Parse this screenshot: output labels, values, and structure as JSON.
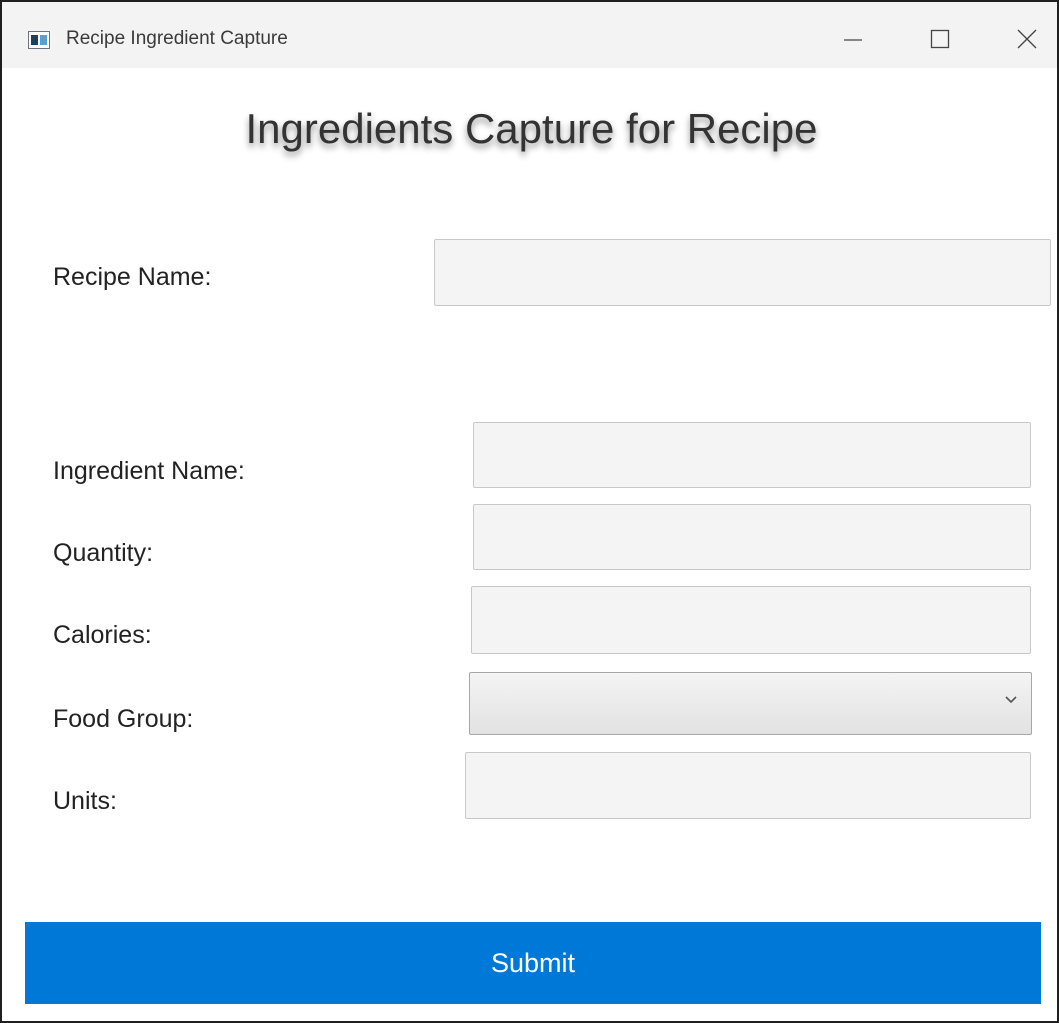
{
  "window": {
    "title": "Recipe Ingredient Capture",
    "controls": {
      "minimize": "minimize-icon",
      "maximize": "maximize-icon",
      "close": "close-icon"
    }
  },
  "form": {
    "heading": "Ingredients Capture for Recipe",
    "recipe_name": {
      "label": "Recipe Name:",
      "value": ""
    },
    "ingredient_name": {
      "label": "Ingredient Name:",
      "value": ""
    },
    "quantity": {
      "label": "Quantity:",
      "value": ""
    },
    "calories": {
      "label": "Calories:",
      "value": ""
    },
    "food_group": {
      "label": "Food Group:",
      "selected": ""
    },
    "units": {
      "label": "Units:",
      "value": ""
    },
    "submit_label": "Submit"
  },
  "colors": {
    "accent": "#0078d7",
    "titlebar": "#f3f3f3",
    "field_bg": "#f4f4f4"
  }
}
